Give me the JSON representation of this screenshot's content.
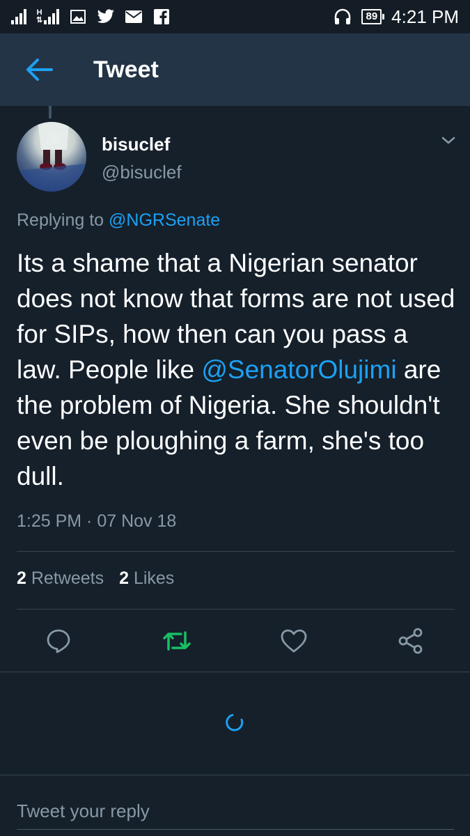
{
  "status_bar": {
    "network_label": "H",
    "battery": "89",
    "time": "4:21 PM",
    "icons": [
      "signal-icon",
      "data-signal-icon",
      "gallery-icon",
      "twitter-icon",
      "mail-icon",
      "facebook-icon",
      "headphones-icon",
      "battery-icon"
    ]
  },
  "app_bar": {
    "title": "Tweet",
    "back_icon": "arrow-left-icon"
  },
  "tweet": {
    "author_name": "bisuclef",
    "author_handle": "@bisuclef",
    "replying_prefix": "Replying to ",
    "replying_handle": "@NGRSenate",
    "text_part1": "Its a shame that a Nigerian senator does not know that forms are not used for SIPs, how then can you pass a law. People like ",
    "text_mention": "@SenatorOlujimi",
    "text_part2": " are the problem of Nigeria. She shouldn't even be ploughing a farm, she's too dull.",
    "timestamp": "1:25 PM · 07 Nov 18",
    "retweet_count": "2",
    "retweet_label": "Retweets",
    "like_count": "2",
    "like_label": "Likes"
  },
  "actions": {
    "reply_icon": "reply-icon",
    "retweet_icon": "retweet-icon",
    "like_icon": "heart-icon",
    "share_icon": "share-icon"
  },
  "reply_bar": {
    "placeholder": "Tweet your reply"
  },
  "colors": {
    "background": "#15202b",
    "app_bar": "#243447",
    "accent": "#1da1f2",
    "retweet_active": "#17bf63",
    "secondary_text": "#8899a6"
  }
}
